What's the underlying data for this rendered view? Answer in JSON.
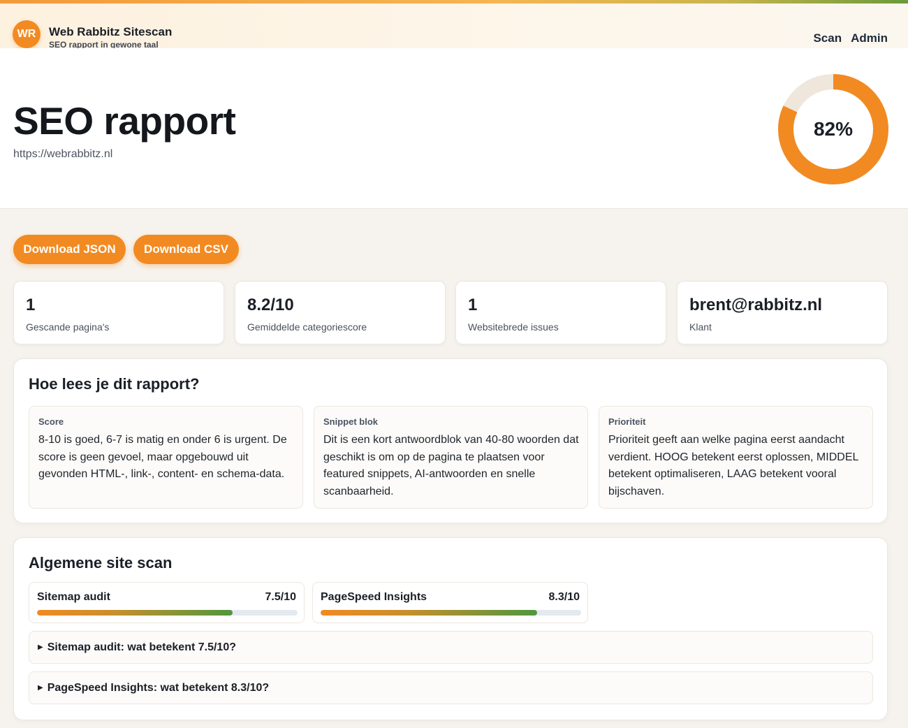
{
  "header": {
    "logo_text": "WR",
    "title": "Web Rabbitz Sitescan",
    "subtitle": "SEO rapport in gewone taal",
    "nav": [
      "Scan",
      "Admin"
    ]
  },
  "hero": {
    "title": "SEO rapport",
    "url": "https://webrabbitz.nl",
    "score_label": "82%",
    "score_fraction": 0.82,
    "score_color": "#f28a22",
    "track_color": "#efe7dc"
  },
  "actions": {
    "download_json": "Download JSON",
    "download_csv": "Download CSV"
  },
  "stats": [
    {
      "value": "1",
      "label": "Gescande pagina's"
    },
    {
      "value": "8.2/10",
      "label": "Gemiddelde categoriescore"
    },
    {
      "value": "1",
      "label": "Websitebrede issues"
    },
    {
      "value": "brent@rabbitz.nl",
      "label": "Klant"
    }
  ],
  "guide": {
    "title": "Hoe lees je dit rapport?",
    "cards": [
      {
        "title": "Score",
        "text": "8-10 is goed, 6-7 is matig en onder 6 is urgent. De score is geen gevoel, maar opgebouwd uit gevonden HTML-, link-, content- en schema-data."
      },
      {
        "title": "Snippet blok",
        "text": "Dit is een kort antwoordblok van 40-80 woorden dat geschikt is om op de pagina te plaatsen voor featured snippets, AI-antwoorden en snelle scanbaarheid."
      },
      {
        "title": "Prioriteit",
        "text": "Prioriteit geeft aan welke pagina eerst aandacht verdient. HOOG betekent eerst oplossen, MIDDEL betekent optimaliseren, LAAG betekent vooral bijschaven."
      }
    ]
  },
  "sitescan": {
    "title": "Algemene site scan",
    "metrics": [
      {
        "name": "Sitemap audit",
        "score": "7.5/10",
        "fraction": 0.75
      },
      {
        "name": "PageSpeed Insights",
        "score": "8.3/10",
        "fraction": 0.83
      }
    ],
    "details": [
      "Sitemap audit: wat betekent 7.5/10?",
      "PageSpeed Insights: wat betekent 8.3/10?"
    ]
  }
}
